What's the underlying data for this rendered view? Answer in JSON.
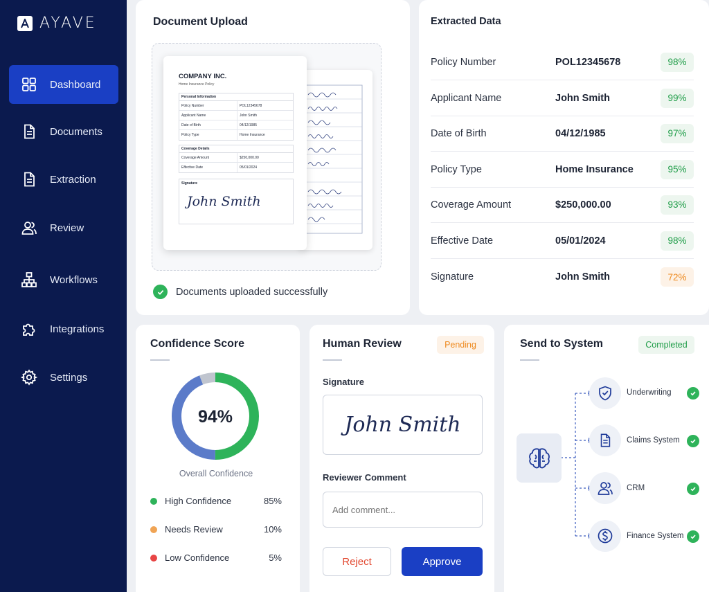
{
  "brand": {
    "name": "AYAVE"
  },
  "sidebar": {
    "items": [
      {
        "label": "Dashboard",
        "icon": "dashboard-icon",
        "active": true
      },
      {
        "label": "Documents",
        "icon": "document-icon"
      },
      {
        "label": "Extraction",
        "icon": "extraction-icon"
      },
      {
        "label": "Review",
        "icon": "users-icon"
      },
      {
        "label": "Workflows",
        "icon": "workflow-icon"
      },
      {
        "label": "Integrations",
        "icon": "puzzle-icon"
      },
      {
        "label": "Settings",
        "icon": "gear-icon"
      }
    ]
  },
  "upload": {
    "title": "Document Upload",
    "status": "Documents uploaded successfully",
    "document": {
      "company": "COMPANY INC.",
      "subtitle": "Home Insurance Policy",
      "section1": "Personal Information",
      "rows1": [
        {
          "k": "Policy Number",
          "v": "POL12345678"
        },
        {
          "k": "Applicant Name",
          "v": "John Smith"
        },
        {
          "k": "Date of Birth",
          "v": "04/12/1985"
        },
        {
          "k": "Policy Type",
          "v": "Home Insurance"
        }
      ],
      "section2": "Coverage Details",
      "rows2": [
        {
          "k": "Coverage Amount",
          "v": "$250,000.00"
        },
        {
          "k": "Effective Date",
          "v": "05/01/2024"
        }
      ],
      "signature_label": "Signature",
      "signature": "John Smith"
    }
  },
  "extracted": {
    "title": "Extracted Data",
    "rows": [
      {
        "label": "Policy Number",
        "value": "POL12345678",
        "confidence": "98%"
      },
      {
        "label": "Applicant Name",
        "value": "John Smith",
        "confidence": "99%"
      },
      {
        "label": "Date of Birth",
        "value": "04/12/1985",
        "confidence": "97%"
      },
      {
        "label": "Policy Type",
        "value": "Home Insurance",
        "confidence": "95%"
      },
      {
        "label": "Coverage Amount",
        "value": "$250,000.00",
        "confidence": "93%"
      },
      {
        "label": "Effective Date",
        "value": "05/01/2024",
        "confidence": "98%"
      },
      {
        "label": "Signature",
        "value": "John Smith",
        "confidence": "72%"
      }
    ]
  },
  "confidence": {
    "title": "Confidence Score",
    "score": "94%",
    "subtitle": "Overall Confidence",
    "legend": [
      {
        "label": "High Confidence",
        "value": "85%",
        "color": "#2eb35a"
      },
      {
        "label": "Needs Review",
        "value": "10%",
        "color": "#f0a455"
      },
      {
        "label": "Low Confidence",
        "value": "5%",
        "color": "#e84545"
      }
    ],
    "ring_colors": {
      "green": "#2eb35a",
      "blue": "#5b7bc9",
      "gray": "#c0c5cf"
    }
  },
  "review": {
    "title": "Human Review",
    "status": "Pending",
    "signature_label": "Signature",
    "signature": "John Smith",
    "comment_label": "Reviewer Comment",
    "comment_placeholder": "Add comment...",
    "reject_label": "Reject",
    "approve_label": "Approve"
  },
  "system": {
    "title": "Send to System",
    "status": "Completed",
    "targets": [
      {
        "label": "Underwriting",
        "icon": "shield-check-icon"
      },
      {
        "label": "Claims System",
        "icon": "document-icon"
      },
      {
        "label": "CRM",
        "icon": "users-icon"
      },
      {
        "label": "Finance System",
        "icon": "dollar-icon"
      }
    ]
  },
  "colors": {
    "sidebar": "#0b1a4e",
    "accent": "#1a3fc4",
    "success": "#2eb35a",
    "warning": "#ee8a1f",
    "danger": "#e84545"
  }
}
